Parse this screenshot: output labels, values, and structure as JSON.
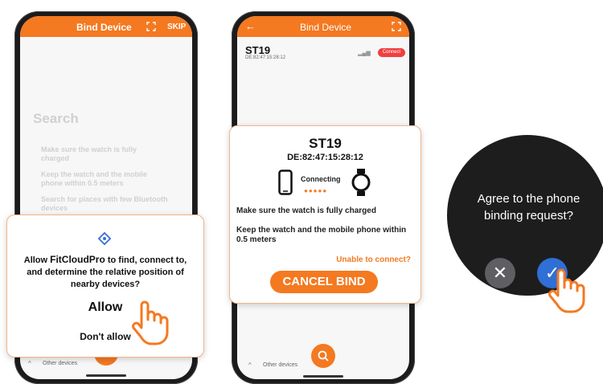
{
  "phone1": {
    "topbar": {
      "title": "Bind Device",
      "skip": "SKIP"
    },
    "search_title": "Search",
    "tips": [
      "Make sure the watch is fully charged",
      "Keep the watch and the mobile phone within 0.5 meters",
      "Search for places with few Bluetooth devices"
    ],
    "dialog": {
      "message_pre": "Allow ",
      "app_name": "FitCloudPro",
      "message_post": " to find, connect to, and determine the relative position of nearby devices?",
      "allow_label": "Allow",
      "deny_label": "Don't allow"
    },
    "bottom_label": "Other devices"
  },
  "phone2": {
    "topbar": {
      "title": "Bind Device"
    },
    "device": {
      "name": "ST19",
      "mac": "DE:82:47:15:28:12",
      "connect_label": "Connect"
    },
    "dialog": {
      "name": "ST19",
      "mac": "DE:82:47:15:28:12",
      "status": "Connecting",
      "tip1": "Make sure the watch is fully charged",
      "tip2": "Keep the watch and the mobile phone within 0.5 meters",
      "unable_link": "Unable to connect?",
      "cancel_label": "CANCEL BIND"
    },
    "bottom_label": "Other devices"
  },
  "watch": {
    "prompt": "Agree to the phone binding request?",
    "reject_icon": "close-icon",
    "accept_icon": "check-icon"
  },
  "colors": {
    "accent": "#f47920",
    "link": "#f47920",
    "reject": "#5f5f63",
    "accept": "#2f6fd6"
  }
}
